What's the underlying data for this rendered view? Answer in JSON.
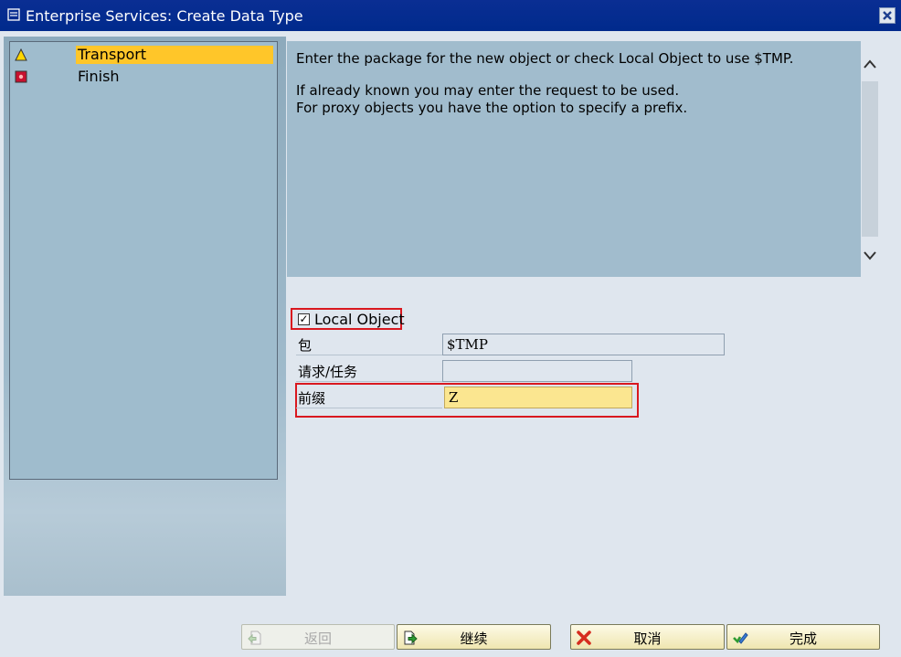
{
  "window": {
    "title": "Enterprise Services: Create Data Type"
  },
  "steps": [
    {
      "label": "Transport",
      "status": "warning",
      "active": true
    },
    {
      "label": "Finish",
      "status": "error",
      "active": false
    }
  ],
  "info": {
    "line1": "Enter the package for the new object or check Local Object to use $TMP.",
    "line2": "If already known you may enter the request to be used.",
    "line3": "For proxy objects you have the option to specify a prefix."
  },
  "form": {
    "local_object": {
      "label": "Local Object",
      "checked": true
    },
    "package": {
      "label": "包",
      "value": "$TMP"
    },
    "request": {
      "label": "请求/任务",
      "value": ""
    },
    "prefix": {
      "label": "前缀",
      "value": "Z"
    }
  },
  "buttons": {
    "back": "返回",
    "continue": "继续",
    "cancel": "取消",
    "finish": "完成"
  },
  "colors": {
    "highlight": "#ffc629",
    "active_field": "#fbe690",
    "focus_box": "#d9181f"
  }
}
